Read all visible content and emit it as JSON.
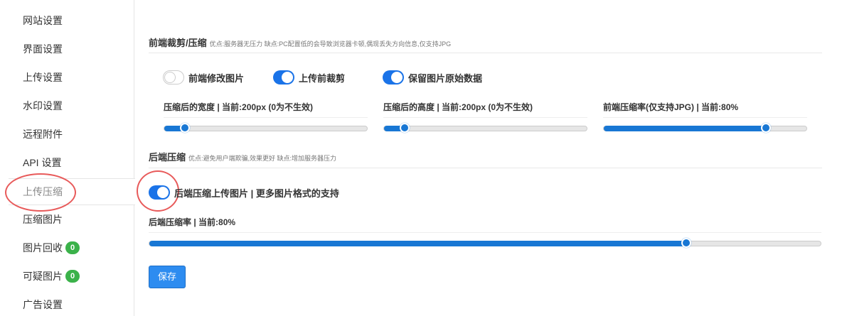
{
  "sidebar": {
    "items": [
      {
        "label": "网站设置"
      },
      {
        "label": "界面设置"
      },
      {
        "label": "上传设置"
      },
      {
        "label": "水印设置"
      },
      {
        "label": "远程附件"
      },
      {
        "label": "API 设置"
      },
      {
        "label": "上传压缩",
        "active": true
      },
      {
        "label": "压缩图片"
      },
      {
        "label": "图片回收",
        "badge": "0"
      },
      {
        "label": "可疑图片",
        "badge": "0"
      },
      {
        "label": "广告设置"
      }
    ]
  },
  "frontend": {
    "title": "前端裁剪/压缩",
    "note": "优点:服务器无压力 缺点:PC配置低的会导致浏览器卡顿,偶现丢失方向信息,仅支持JPG",
    "toggles": [
      {
        "label": "前端修改图片",
        "on": false
      },
      {
        "label": "上传前裁剪",
        "on": true
      },
      {
        "label": "保留图片原始数据",
        "on": true
      }
    ],
    "sliders": [
      {
        "label": "压缩后的宽度 | 当前:200px (0为不生效)",
        "value": 200,
        "fraction": 0.1
      },
      {
        "label": "压缩后的高度 | 当前:200px (0为不生效)",
        "value": 200,
        "fraction": 0.1
      },
      {
        "label": "前端压缩率(仅支持JPG) | 当前:80%",
        "value": 80,
        "fraction": 0.8
      }
    ]
  },
  "backend": {
    "title": "后端压缩",
    "note": "优点:避免用户端欺骗,效果更好 缺点:增加服务器压力",
    "toggle": {
      "label": "后端压缩上传图片 | 更多图片格式的支持",
      "on": true
    },
    "slider": {
      "label": "后端压缩率 | 当前:80%",
      "value": 80,
      "fraction": 0.8
    }
  },
  "save_label": "保存",
  "colors": {
    "accent": "#1877d4",
    "badge": "#3bb24a",
    "annotation": "#e85a5a"
  }
}
